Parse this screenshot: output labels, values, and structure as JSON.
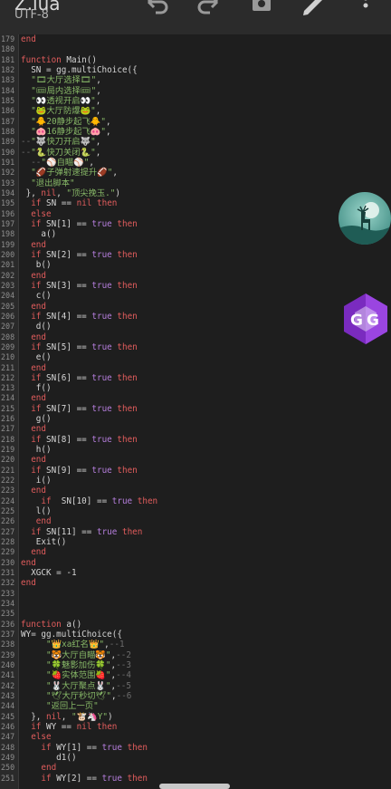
{
  "header": {
    "title": "Z.lua",
    "subtitle": "UTF-8",
    "icons": [
      "undo-icon",
      "redo-icon",
      "save-icon",
      "edit-icon",
      "more-vert-icon"
    ]
  },
  "code_lines": [
    {
      "n": "179",
      "t": "end"
    },
    {
      "n": "180",
      "t": ""
    },
    {
      "n": "181",
      "t": "function Main()"
    },
    {
      "n": "182",
      "t": "  SN = gg.multiChoice({"
    },
    {
      "n": "183",
      "t": "  \"🎞大厅选择🎞\","
    },
    {
      "n": "184",
      "t": "  \"🎟局内选择🎟\","
    },
    {
      "n": "185",
      "t": "  \"👀透视开启👀\","
    },
    {
      "n": "186",
      "t": "  \"🐸大厅防爆🐸\","
    },
    {
      "n": "187",
      "t": "  \"🐥20静步起飞🐥\","
    },
    {
      "n": "188",
      "t": "  \"🐽16静步起飞🐽\","
    },
    {
      "n": "189",
      "t": "--\"🐺快刀开启🐺\","
    },
    {
      "n": "190",
      "t": "--\"🐍快刀关闭🐍\","
    },
    {
      "n": "191",
      "t": "  --\"⚾自瞄⚾\","
    },
    {
      "n": "192",
      "t": "  \"🏈子弹射速提升🏈\","
    },
    {
      "n": "193",
      "t": "  \"退出脚本\""
    },
    {
      "n": "194",
      "t": " }, nil, \"顶尖挽玉.\")"
    },
    {
      "n": "195",
      "t": "  if SN == nil then"
    },
    {
      "n": "196",
      "t": "  else"
    },
    {
      "n": "197",
      "t": "  if SN[1] == true then"
    },
    {
      "n": "198",
      "t": "    a()"
    },
    {
      "n": "199",
      "t": "  end"
    },
    {
      "n": "200",
      "t": "  if SN[2] == true then"
    },
    {
      "n": "201",
      "t": "   b()"
    },
    {
      "n": "202",
      "t": "  end"
    },
    {
      "n": "203",
      "t": "  if SN[3] == true then"
    },
    {
      "n": "204",
      "t": "   c()"
    },
    {
      "n": "205",
      "t": "  end"
    },
    {
      "n": "206",
      "t": "  if SN[4] == true then"
    },
    {
      "n": "207",
      "t": "   d()"
    },
    {
      "n": "208",
      "t": "  end"
    },
    {
      "n": "209",
      "t": "  if SN[5] == true then"
    },
    {
      "n": "210",
      "t": "   e()"
    },
    {
      "n": "211",
      "t": "  end"
    },
    {
      "n": "212",
      "t": "  if SN[6] == true then"
    },
    {
      "n": "213",
      "t": "   f()"
    },
    {
      "n": "214",
      "t": "  end"
    },
    {
      "n": "215",
      "t": "  if SN[7] == true then"
    },
    {
      "n": "216",
      "t": "   g()"
    },
    {
      "n": "217",
      "t": "  end"
    },
    {
      "n": "218",
      "t": "  if SN[8] == true then"
    },
    {
      "n": "219",
      "t": "   h()"
    },
    {
      "n": "220",
      "t": "  end"
    },
    {
      "n": "221",
      "t": "  if SN[9] == true then"
    },
    {
      "n": "222",
      "t": "   i()"
    },
    {
      "n": "223",
      "t": "  end"
    },
    {
      "n": "224",
      "t": "    if  SN[10] == true then"
    },
    {
      "n": "225",
      "t": "   l()"
    },
    {
      "n": "226",
      "t": "   end"
    },
    {
      "n": "227",
      "t": "  if SN[11] == true then"
    },
    {
      "n": "228",
      "t": "   Exit()"
    },
    {
      "n": "229",
      "t": "  end"
    },
    {
      "n": "230",
      "t": "end"
    },
    {
      "n": "231",
      "t": "  XGCK = -1"
    },
    {
      "n": "232",
      "t": "end"
    },
    {
      "n": "233",
      "t": ""
    },
    {
      "n": "234",
      "t": ""
    },
    {
      "n": "235",
      "t": ""
    },
    {
      "n": "236",
      "t": "function a()"
    },
    {
      "n": "237",
      "t": "WY= gg.multiChoice({"
    },
    {
      "n": "238",
      "t": "     \"👑xa红名👑\",--1"
    },
    {
      "n": "239",
      "t": "     \"🐯大厅自瞄🐯\",--2"
    },
    {
      "n": "240",
      "t": "     \"🍀魅影加伤🍀\",--3"
    },
    {
      "n": "241",
      "t": "     \"🍓实体范围🍓\",--4"
    },
    {
      "n": "242",
      "t": "     \"🐰大厅聚点🐰\",--5"
    },
    {
      "n": "243",
      "t": "     \"🕊大厅秒切🕊\",--6"
    },
    {
      "n": "244",
      "t": "     \"返回上一页\""
    },
    {
      "n": "245",
      "t": "  }, nil, \"🐮🦄Y\")"
    },
    {
      "n": "246",
      "t": "  if WY == nil then"
    },
    {
      "n": "247",
      "t": "  else"
    },
    {
      "n": "248",
      "t": "    if WY[1] == true then"
    },
    {
      "n": "249",
      "t": "       d1()"
    },
    {
      "n": "250",
      "t": "    end"
    },
    {
      "n": "251",
      "t": "    if WY[2] == true then"
    }
  ],
  "colors": {
    "keyword": "#e05c5c",
    "boolean": "#b57edc",
    "string": "#87b867",
    "text": "#d6d6d6",
    "line_number": "#8e8e8e"
  },
  "floating": [
    "deer-app-icon",
    "gg-app-icon"
  ]
}
